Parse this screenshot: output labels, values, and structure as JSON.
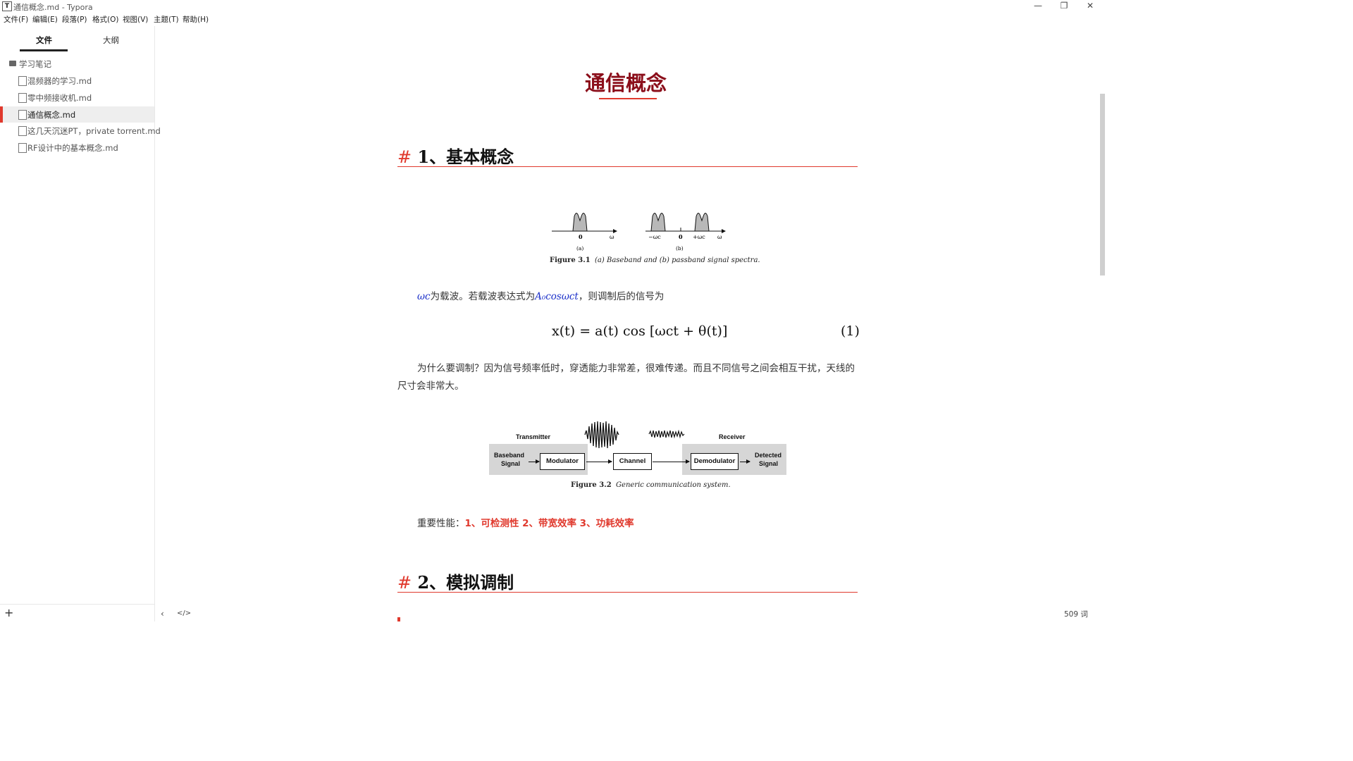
{
  "window": {
    "app_icon": "T",
    "title": "通信概念.md - Typora",
    "controls": {
      "minimize": "—",
      "restore": "❐",
      "close": "✕"
    }
  },
  "menu": [
    "文件(F)",
    "编辑(E)",
    "段落(P)",
    "格式(O)",
    "视图(V)",
    "主题(T)",
    "帮助(H)"
  ],
  "sidebar": {
    "tabs": [
      "文件",
      "大纲"
    ],
    "active_tab": "文件",
    "folder": "学习笔记",
    "files": [
      {
        "label": "混频器的学习.md",
        "active": false
      },
      {
        "label": "零中频接收机.md",
        "active": false
      },
      {
        "label": "通信概念.md",
        "active": true
      },
      {
        "label": "这几天沉迷PT，private torrent.md",
        "active": false
      },
      {
        "label": "RF设计中的基本概念.md",
        "active": false
      }
    ],
    "add_button": "+"
  },
  "doc": {
    "title": "通信概念",
    "h1_1": {
      "hash": "#",
      "text": "1、基本概念"
    },
    "fig1": {
      "labels": {
        "zero": "0",
        "omega": "ω",
        "a": "(a)",
        "b": "(b)",
        "neg_wc": "−ωc",
        "pos_wc": "+ωc"
      },
      "caption_bold": "Figure 3.1",
      "caption_italic": "(a) Baseband and (b) passband signal spectra."
    },
    "para1": {
      "wc": "ωc",
      "t1": "为载波。若载波表达式为",
      "expr": "A₀cosωct",
      "t2": "，则调制后的信号为"
    },
    "equation": "x(t) = a(t) cos [ωct + θ(t)]",
    "equation_number": "(1)",
    "para2": "为什么要调制？因为信号频率低时，穿透能力非常差，很难传递。而且不同信号之间会相互干扰，天线的尺寸会非常大。",
    "fig2": {
      "transmitter": "Transmitter",
      "receiver": "Receiver",
      "baseband_1": "Baseband",
      "baseband_2": "Signal",
      "modulator": "Modulator",
      "channel": "Channel",
      "demodulator": "Demodulator",
      "detected_1": "Detected",
      "detected_2": "Signal",
      "caption_bold": "Figure 3.2",
      "caption_italic": "Generic communication system."
    },
    "perf": {
      "label": "重要性能：",
      "items": "1、可检测性 2、带宽效率 3、功耗效率"
    },
    "h1_2": {
      "hash": "#",
      "text": "2、模拟调制"
    }
  },
  "status": {
    "back": "‹",
    "source": "</>",
    "word_count": "509 词"
  }
}
